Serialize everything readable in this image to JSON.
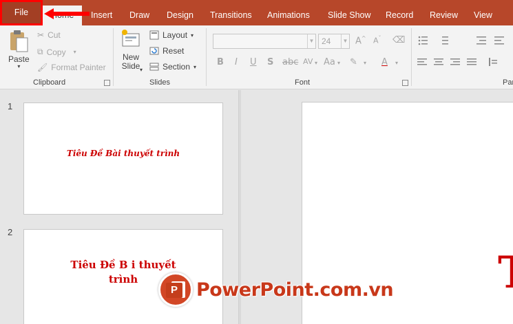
{
  "ribbon_tabs": {
    "file": "File",
    "home": "Home",
    "insert": "Insert",
    "draw": "Draw",
    "design": "Design",
    "transitions": "Transitions",
    "animations": "Animations",
    "slide_show": "Slide Show",
    "record": "Record",
    "review": "Review",
    "view": "View"
  },
  "clipboard": {
    "paste": "Paste",
    "cut": "Cut",
    "copy": "Copy",
    "format_painter": "Format Painter",
    "group_label": "Clipboard"
  },
  "slides": {
    "new_slide_line1": "New",
    "new_slide_line2": "Slide",
    "layout": "Layout",
    "reset": "Reset",
    "section": "Section",
    "group_label": "Slides"
  },
  "font": {
    "font_name": "",
    "font_size": "24",
    "bold": "B",
    "italic": "I",
    "underline": "U",
    "strikethrough": "S",
    "spacing": "AV",
    "change_case": "Aa",
    "font_color": "A",
    "group_label": "Font"
  },
  "paragraph": {
    "group_label": "Par"
  },
  "thumbnails": [
    {
      "number": "1",
      "title": "Tiêu Đề Bài thuyết trình"
    },
    {
      "number": "2",
      "title_line1": "Tiêu Đề B  i thuyết",
      "title_line2": "trình"
    }
  ],
  "editor": {
    "partial_glyph": "T"
  },
  "watermark": {
    "logo_letter": "P",
    "text": "PowerPoint.com.vn"
  },
  "colors": {
    "ribbon_tab_bg": "#b7472a",
    "title_red": "#cc0000",
    "annotation_red": "#ff0000"
  }
}
